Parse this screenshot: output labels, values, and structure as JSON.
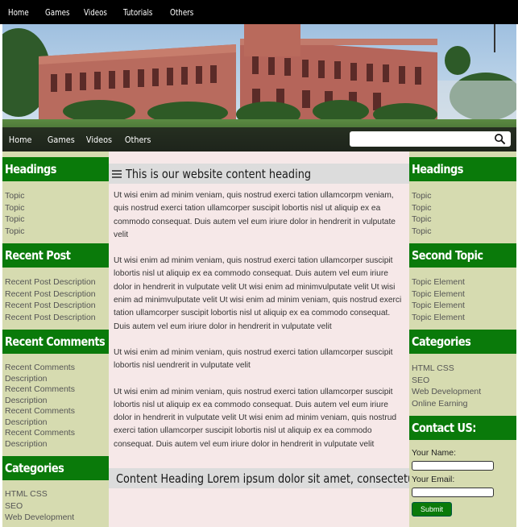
{
  "top_nav": [
    "Home",
    "Games",
    "Videos",
    "Tutorials",
    "Others"
  ],
  "second_nav": [
    "Home",
    "Games",
    "Videos",
    "Others"
  ],
  "search": {
    "placeholder": "",
    "icon": "search-icon"
  },
  "left_sidebar": {
    "headings": {
      "title": "Headings",
      "items": [
        "Topic",
        "Topic",
        "Topic",
        "Topic"
      ]
    },
    "recent_post": {
      "title": "Recent Post",
      "items": [
        "Recent Post Description",
        "Recent Post Description",
        "Recent Post Description",
        "Recent Post Description"
      ]
    },
    "recent_comments": {
      "title": "Recent Comments",
      "items": [
        "Recent Comments Description",
        "Recent Comments Description",
        "Recent Comments Description",
        "Recent Comments Description"
      ]
    },
    "categories": {
      "title": "Categories",
      "items": [
        "HTML CSS",
        "SEO",
        "Web Development"
      ]
    }
  },
  "main": {
    "heading1": "This is our website content heading",
    "paragraphs": [
      "Ut wisi enim ad minim veniam, quis nostrud exerci tation ullamcorpm veniam, quis nostrud exerci tation ullamcorper suscipit lobortis nisl ut aliquip ex ea commodo consequat. Duis autem vel eum iriure dolor in hendrerit in vulputate velit",
      "Ut wisi enim ad minim veniam, quis nostrud exerci tation ullamcorper suscipit lobortis nisl ut aliquip ex ea commodo consequat. Duis autem vel eum iriure dolor in hendrerit in vulputate velit Ut wisi enim ad minimvulputate velit Ut wisi enim ad minimvulputate velit Ut wisi enim ad minim veniam, quis nostrud exerci tation ullamcorper suscipit lobortis nisl ut aliquip ex ea commodo consequat. Duis autem vel eum iriure dolor in hendrerit in vulputate velit",
      "Ut wisi enim ad minim veniam, quis nostrud exerci tation ullamcorper suscipit lobortis nisl uendrerit in vulputate velit",
      "Ut wisi enim ad minim veniam, quis nostrud exerci tation ullamcorper suscipit lobortis nisl ut aliquip ex ea commodo consequat. Duis autem vel eum iriure dolor in hendrerit in vulputate velit Ut wisi enim ad minim veniam, quis nostrud exerci tation ullamcorper suscipit lobortis nisl ut aliquip ex ea commodo consequat. Duis autem vel eum iriure dolor in hendrerit in vulputate velit"
    ],
    "heading2": "Content Heading Lorem ipsum dolor sit amet, consectetuer"
  },
  "right_sidebar": {
    "headings": {
      "title": "Headings",
      "items": [
        "Topic",
        "Topic",
        "Topic",
        "Topic"
      ]
    },
    "second_topic": {
      "title": "Second Topic",
      "items": [
        "Topic Element",
        "Topic Element",
        "Topic Element",
        "Topic Element"
      ]
    },
    "categories": {
      "title": "Categories",
      "items": [
        "HTML CSS",
        "SEO",
        "Web Development",
        "Online Earning"
      ]
    },
    "contact": {
      "title": "Contact US:",
      "name_label": "Your Name:",
      "email_label": "Your Email:",
      "submit_label": "Submit"
    }
  },
  "colors": {
    "widget_green": "#0a7a0a",
    "sidebar_bg": "#d6dbb0",
    "main_bg": "#f6e8e8",
    "heading_bar": "#dcdcdc",
    "nav_bg": "#000000"
  }
}
